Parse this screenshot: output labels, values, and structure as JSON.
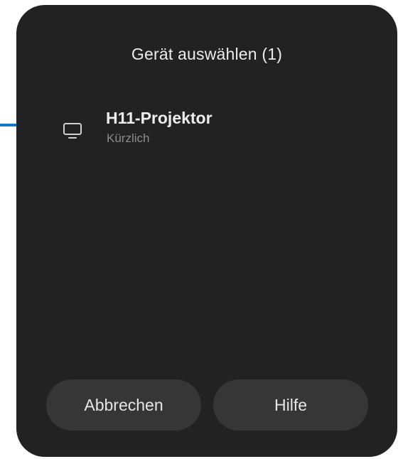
{
  "dialog": {
    "title": "Gerät auswählen (1)"
  },
  "devices": [
    {
      "name": "H11-Projektor",
      "subtitle": "Kürzlich",
      "icon": "monitor-icon"
    }
  ],
  "buttons": {
    "cancel_label": "Abbrechen",
    "help_label": "Hilfe"
  },
  "annotation": {
    "icon": "arrow-right-icon",
    "color": "#1a73c8"
  },
  "colors": {
    "dialog_background": "#222222",
    "button_background": "#363636",
    "text_primary": "#ececec",
    "text_secondary": "#8c8c8c"
  }
}
